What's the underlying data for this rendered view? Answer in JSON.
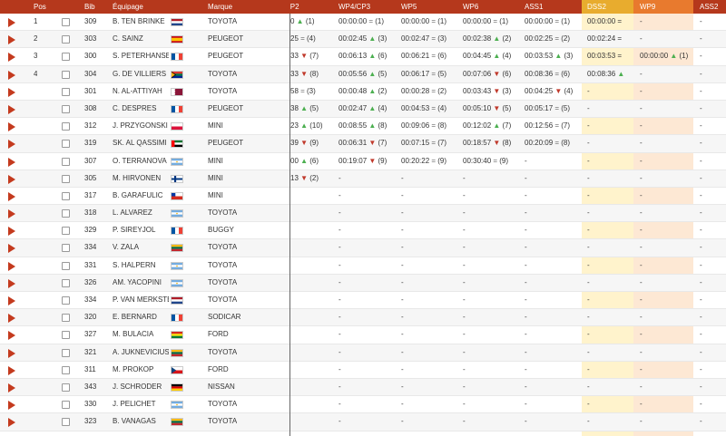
{
  "header": {
    "pos": "Pos",
    "bib": "Bib",
    "equipage": "Équipage",
    "marque": "Marque",
    "cp2": "CP2",
    "wp4": "WP4/CP3",
    "wp5": "WP5",
    "wp6": "WP6",
    "ass1": "ASS1",
    "dss2": "DSS2",
    "wp9": "WP9",
    "ass2": "ASS2"
  },
  "colors": {
    "header_bg": "#b5381c",
    "dss2_bg": "#e8ac2e",
    "wp9_bg": "#e87a2e",
    "up": "#4caf50",
    "down": "#c0392b"
  },
  "rows": [
    {
      "pos": "1",
      "bib": "309",
      "name": "B. TEN BRINKE",
      "flag": "nl",
      "team": "TOYOTA",
      "cp2": "0 ▲ (1)",
      "wp4": "00:00:00 = (1)",
      "wp5": "00:00:00 = (1)",
      "wp6": "00:00:00 = (1)",
      "ass1": "00:00:00 = (1)",
      "dss2": "00:00:00 =",
      "wp9": "-",
      "ass2": "-"
    },
    {
      "pos": "2",
      "bib": "303",
      "name": "C. SAINZ",
      "flag": "es",
      "team": "PEUGEOT",
      "cp2": "25 = (4)",
      "wp4": "00:02:45 ▲ (3)",
      "wp5": "00:02:47 = (3)",
      "wp6": "00:02:38 ▲ (2)",
      "ass1": "00:02:25 = (2)",
      "dss2": "00:02:24 =",
      "wp9": "-",
      "ass2": "-"
    },
    {
      "pos": "3",
      "bib": "300",
      "name": "S. PETERHANSEL",
      "flag": "fr",
      "team": "PEUGEOT",
      "cp2": "33 ▼ (7)",
      "wp4": "00:06:13 ▲ (6)",
      "wp5": "00:06:21 = (6)",
      "wp6": "00:04:45 ▲ (4)",
      "ass1": "00:03:53 ▲ (3)",
      "dss2": "00:03:53 =",
      "wp9": "00:00:00 ▲ (1)",
      "ass2": "-"
    },
    {
      "pos": "4",
      "bib": "304",
      "name": "G. DE VILLIERS",
      "flag": "za",
      "team": "TOYOTA",
      "cp2": "33 ▼ (8)",
      "wp4": "00:05:56 ▲ (5)",
      "wp5": "00:06:17 = (5)",
      "wp6": "00:07:06 ▼ (6)",
      "ass1": "00:08:36 = (6)",
      "dss2": "00:08:36 ▲",
      "wp9": "-",
      "ass2": "-"
    },
    {
      "pos": "",
      "bib": "301",
      "name": "N. AL-ATTIYAH",
      "flag": "qa",
      "team": "TOYOTA",
      "cp2": "58 = (3)",
      "wp4": "00:00:48 ▲ (2)",
      "wp5": "00:00:28 = (2)",
      "wp6": "00:03:43 ▼ (3)",
      "ass1": "00:04:25 ▼ (4)",
      "dss2": "-",
      "wp9": "-",
      "ass2": "-"
    },
    {
      "pos": "",
      "bib": "308",
      "name": "C. DESPRES",
      "flag": "fr",
      "team": "PEUGEOT",
      "cp2": "38 ▲ (5)",
      "wp4": "00:02:47 ▲ (4)",
      "wp5": "00:04:53 = (4)",
      "wp6": "00:05:10 ▼ (5)",
      "ass1": "00:05:17 = (5)",
      "dss2": "-",
      "wp9": "-",
      "ass2": "-"
    },
    {
      "pos": "",
      "bib": "312",
      "name": "J. PRZYGONSKI",
      "flag": "pl",
      "team": "MINI",
      "cp2": "23 ▲ (10)",
      "wp4": "00:08:55 ▲ (8)",
      "wp5": "00:09:06 = (8)",
      "wp6": "00:12:02 ▲ (7)",
      "ass1": "00:12:56 = (7)",
      "dss2": "-",
      "wp9": "-",
      "ass2": "-"
    },
    {
      "pos": "",
      "bib": "319",
      "name": "SK. AL QASSIMI",
      "flag": "ae",
      "team": "PEUGEOT",
      "cp2": "39 ▼ (9)",
      "wp4": "00:06:31 ▼ (7)",
      "wp5": "00:07:15 = (7)",
      "wp6": "00:18:57 ▼ (8)",
      "ass1": "00:20:09 = (8)",
      "dss2": "-",
      "wp9": "-",
      "ass2": "-"
    },
    {
      "pos": "",
      "bib": "307",
      "name": "O. TERRANOVA",
      "flag": "ar",
      "team": "MINI",
      "cp2": "00 ▲ (6)",
      "wp4": "00:19:07 ▼ (9)",
      "wp5": "00:20:22 = (9)",
      "wp6": "00:30:40 = (9)",
      "ass1": "-",
      "dss2": "-",
      "wp9": "-",
      "ass2": "-"
    },
    {
      "pos": "",
      "bib": "305",
      "name": "M. HIRVONEN",
      "flag": "fi",
      "team": "MINI",
      "cp2": "13 ▼ (2)",
      "wp4": "-",
      "wp5": "-",
      "wp6": "-",
      "ass1": "-",
      "dss2": "-",
      "wp9": "-",
      "ass2": "-"
    },
    {
      "pos": "",
      "bib": "317",
      "name": "B. GARAFULIC",
      "flag": "cl",
      "team": "MINI",
      "cp2": "",
      "wp4": "-",
      "wp5": "-",
      "wp6": "-",
      "ass1": "-",
      "dss2": "-",
      "wp9": "-",
      "ass2": "-"
    },
    {
      "pos": "",
      "bib": "318",
      "name": "L. ALVAREZ",
      "flag": "ar",
      "team": "TOYOTA",
      "cp2": "",
      "wp4": "-",
      "wp5": "-",
      "wp6": "-",
      "ass1": "-",
      "dss2": "-",
      "wp9": "-",
      "ass2": "-"
    },
    {
      "pos": "",
      "bib": "329",
      "name": "P. SIREYJOL",
      "flag": "fr",
      "team": "BUGGY",
      "cp2": "",
      "wp4": "-",
      "wp5": "-",
      "wp6": "-",
      "ass1": "-",
      "dss2": "-",
      "wp9": "-",
      "ass2": "-"
    },
    {
      "pos": "",
      "bib": "334",
      "name": "V. ZALA",
      "flag": "lt",
      "team": "TOYOTA",
      "cp2": "",
      "wp4": "-",
      "wp5": "-",
      "wp6": "-",
      "ass1": "-",
      "dss2": "-",
      "wp9": "-",
      "ass2": "-"
    },
    {
      "pos": "",
      "bib": "331",
      "name": "S. HALPERN",
      "flag": "ar",
      "team": "TOYOTA",
      "cp2": "",
      "wp4": "-",
      "wp5": "-",
      "wp6": "-",
      "ass1": "-",
      "dss2": "-",
      "wp9": "-",
      "ass2": "-"
    },
    {
      "pos": "",
      "bib": "326",
      "name": "AM. YACOPINI",
      "flag": "ar",
      "team": "TOYOTA",
      "cp2": "",
      "wp4": "-",
      "wp5": "-",
      "wp6": "-",
      "ass1": "-",
      "dss2": "-",
      "wp9": "-",
      "ass2": "-"
    },
    {
      "pos": "",
      "bib": "334",
      "name": "P. VAN MERKSTEIJN",
      "flag": "nl",
      "team": "TOYOTA",
      "cp2": "",
      "wp4": "-",
      "wp5": "-",
      "wp6": "-",
      "ass1": "-",
      "dss2": "-",
      "wp9": "-",
      "ass2": "-"
    },
    {
      "pos": "",
      "bib": "320",
      "name": "E. BERNARD",
      "flag": "fr",
      "team": "SODICAR",
      "cp2": "",
      "wp4": "-",
      "wp5": "-",
      "wp6": "-",
      "ass1": "-",
      "dss2": "-",
      "wp9": "-",
      "ass2": "-"
    },
    {
      "pos": "",
      "bib": "327",
      "name": "M. BULACIA",
      "flag": "bo",
      "team": "FORD",
      "cp2": "",
      "wp4": "-",
      "wp5": "-",
      "wp6": "-",
      "ass1": "-",
      "dss2": "-",
      "wp9": "-",
      "ass2": "-"
    },
    {
      "pos": "",
      "bib": "321",
      "name": "A. JUKNEVICIUS",
      "flag": "lt",
      "team": "TOYOTA",
      "cp2": "",
      "wp4": "-",
      "wp5": "-",
      "wp6": "-",
      "ass1": "-",
      "dss2": "-",
      "wp9": "-",
      "ass2": "-"
    },
    {
      "pos": "",
      "bib": "311",
      "name": "M. PROKOP",
      "flag": "cz",
      "team": "FORD",
      "cp2": "",
      "wp4": "-",
      "wp5": "-",
      "wp6": "-",
      "ass1": "-",
      "dss2": "-",
      "wp9": "-",
      "ass2": "-"
    },
    {
      "pos": "",
      "bib": "343",
      "name": "J. SCHRODER",
      "flag": "de",
      "team": "NISSAN",
      "cp2": "",
      "wp4": "-",
      "wp5": "-",
      "wp6": "-",
      "ass1": "-",
      "dss2": "-",
      "wp9": "-",
      "ass2": "-"
    },
    {
      "pos": "",
      "bib": "330",
      "name": "J. PELICHET",
      "flag": "ar",
      "team": "TOYOTA",
      "cp2": "",
      "wp4": "-",
      "wp5": "-",
      "wp6": "-",
      "ass1": "-",
      "dss2": "-",
      "wp9": "-",
      "ass2": "-"
    },
    {
      "pos": "",
      "bib": "323",
      "name": "B. VANAGAS",
      "flag": "lt",
      "team": "TOYOTA",
      "cp2": "",
      "wp4": "-",
      "wp5": "-",
      "wp6": "-",
      "ass1": "-",
      "dss2": "-",
      "wp9": "-",
      "ass2": "-"
    }
  ]
}
